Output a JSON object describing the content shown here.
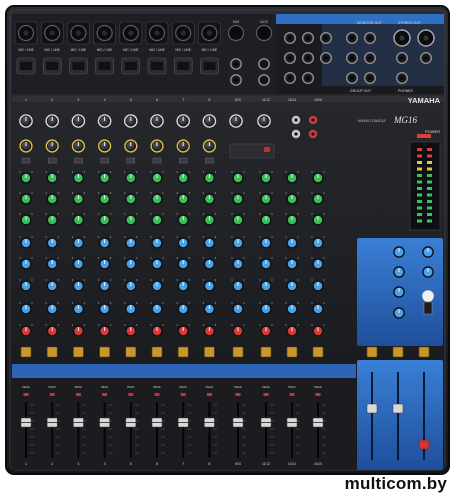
{
  "mixer": {
    "brand": "YAMAHA",
    "model": "MG16",
    "subtitle": "MIXING CONSOLE",
    "mono_channels": 8,
    "stereo_channels": 4,
    "mono_channel_numbers": [
      "1",
      "2",
      "3",
      "4",
      "5",
      "6",
      "7",
      "8"
    ],
    "stereo_channel_numbers": [
      "9/10",
      "11/12",
      "13/14",
      "15/16"
    ],
    "input_label": "MIC / LINE",
    "top_strip_labels": [
      "9/10",
      "11/12"
    ],
    "peak_label": "PEAK",
    "power_label": "POWER",
    "phones_label": "PHONES",
    "group_out_label": "GROUP OUT",
    "monitor_out_label": "MONITOR OUT",
    "stereo_out_label": "STEREO OUT",
    "colors": {
      "body": "#1b1c20",
      "panel": "#23252a",
      "blue_accent": "#2f6fc4",
      "knob_green": "#3bbf5a",
      "knob_blue": "#4aa3e8",
      "knob_red": "#d83a3a",
      "knob_yellow": "#e0c24a",
      "button_amber": "#c8972e"
    }
  },
  "watermark": {
    "text": "multicom.by"
  }
}
